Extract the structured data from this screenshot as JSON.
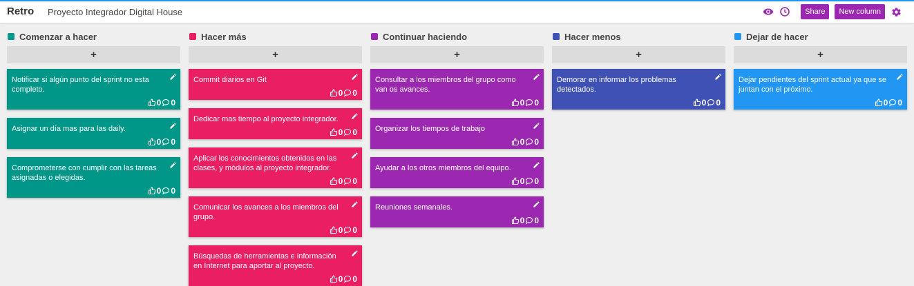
{
  "header": {
    "app_title": "Retro",
    "board_title": "Proyecto Integrador Digital House",
    "share_label": "Share",
    "new_column_label": "New column"
  },
  "colors": {
    "accent": "#9c27b0",
    "topbar_line": "#2196f3"
  },
  "add_label": "+",
  "columns": [
    {
      "title": "Comenzar a hacer",
      "color": "#009688",
      "cards": [
        {
          "text": "Notificar si algún punto del sprint no esta completo.",
          "likes": "0",
          "comments": "0"
        },
        {
          "text": "Asignar un día mas para las daily.",
          "likes": "0",
          "comments": "0"
        },
        {
          "text": "Comprometerse con cumplir con las tareas asignadas o elegidas.",
          "likes": "0",
          "comments": "0"
        }
      ]
    },
    {
      "title": "Hacer más",
      "color": "#e91e63",
      "cards": [
        {
          "text": "Commit diarios en Git",
          "likes": "0",
          "comments": "0"
        },
        {
          "text": "Dedicar mas tiempo al proyecto integrador.",
          "likes": "0",
          "comments": "0"
        },
        {
          "text": "Aplicar los conocimientos obtenidos en las clases, y módulos al proyecto integrador.",
          "likes": "0",
          "comments": "0"
        },
        {
          "text": "Comunicar los avances a los miembros del grupo.",
          "likes": "0",
          "comments": "0"
        },
        {
          "text": "Búsquedas de herramientas e información en Internet para aportar al proyecto.",
          "likes": "0",
          "comments": "0"
        }
      ]
    },
    {
      "title": "Continuar haciendo",
      "color": "#9c27b0",
      "cards": [
        {
          "text": "Consultar a los miembros del grupo como van os avances.",
          "likes": "0",
          "comments": "0"
        },
        {
          "text": "Organizar los tiempos de trabajo",
          "likes": "0",
          "comments": "0"
        },
        {
          "text": "Ayudar a los otros miembros del equipo.",
          "likes": "0",
          "comments": "0"
        },
        {
          "text": "Reuniones semanales.",
          "likes": "0",
          "comments": "0"
        }
      ]
    },
    {
      "title": "Hacer menos",
      "color": "#3f51b5",
      "cards": [
        {
          "text": "Demorar en informar los problemas detectados.",
          "likes": "0",
          "comments": "0"
        }
      ]
    },
    {
      "title": "Dejar de hacer",
      "color": "#2196f3",
      "cards": [
        {
          "text": "Dejar pendientes del sprint actual ya que se juntan con el próximo.",
          "likes": "0",
          "comments": "0"
        }
      ]
    }
  ]
}
